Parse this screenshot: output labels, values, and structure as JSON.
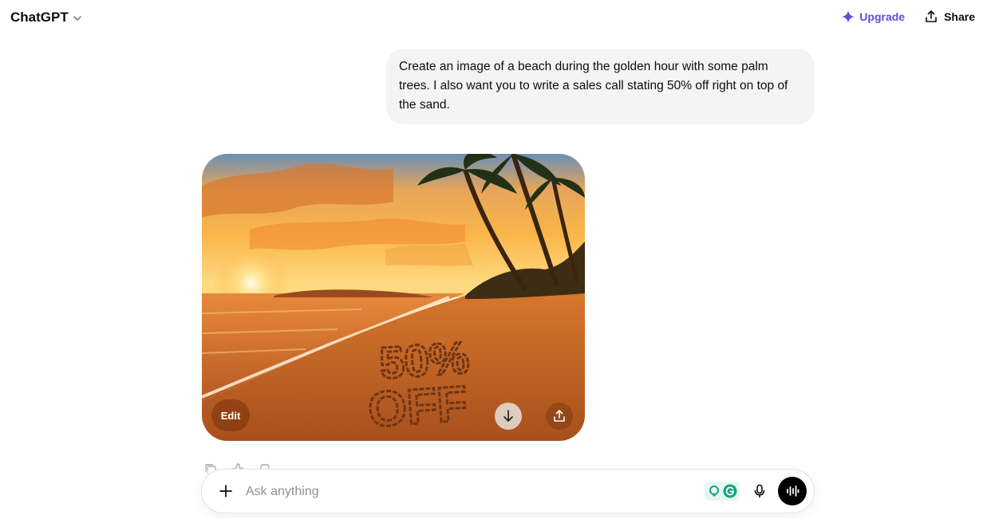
{
  "header": {
    "model_label": "ChatGPT",
    "upgrade_label": "Upgrade",
    "share_label": "Share",
    "accent_color": "#5b4fd6"
  },
  "conversation": {
    "user_message": "Create an image of a beach during the golden hour with some palm trees. I also want you to write a sales call stating 50% off right on top of the sand.",
    "generated_image": {
      "sand_text_line1": "50%",
      "sand_text_line2": "OFF",
      "edit_label": "Edit",
      "icons": [
        "download-icon",
        "share-icon"
      ]
    },
    "action_icons": [
      "copy-icon",
      "thumbs-up-icon",
      "thumbs-down-icon"
    ]
  },
  "composer": {
    "placeholder": "Ask anything",
    "icons": [
      "plus-icon",
      "grammarly-icon",
      "mic-icon",
      "voice-mode-icon"
    ]
  }
}
